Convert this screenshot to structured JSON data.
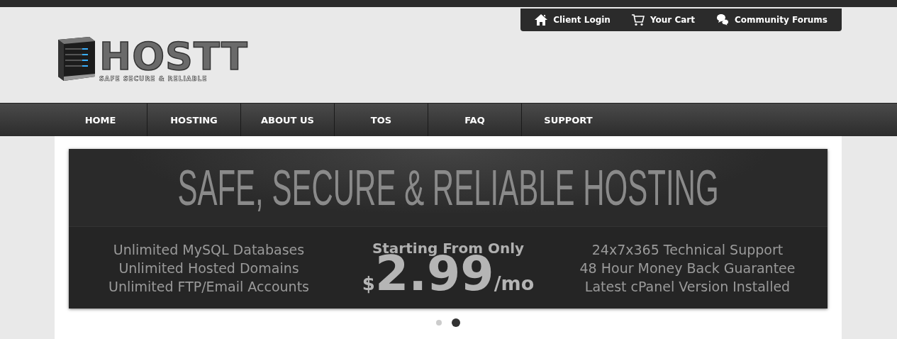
{
  "top_links": [
    {
      "kind": "home",
      "label": "Client Login"
    },
    {
      "kind": "cart",
      "label": "Your Cart"
    },
    {
      "kind": "forum",
      "label": "Community Forums"
    }
  ],
  "logo": {
    "name": "HOSTT",
    "tagline": "SAFE SECURE & RELIABLE"
  },
  "nav": [
    {
      "label": "HOME"
    },
    {
      "label": "HOSTING"
    },
    {
      "label": "ABOUT US"
    },
    {
      "label": "TOS"
    },
    {
      "label": "FAQ"
    },
    {
      "label": "SUPPORT"
    }
  ],
  "banner": {
    "headline": "SAFE, SECURE & RELIABLE HOSTING",
    "left_features": [
      "Unlimited MySQL Databases",
      "Unlimited Hosted Domains",
      "Unlimited FTP/Email Accounts"
    ],
    "price_intro": "Starting From Only",
    "currency": "$",
    "price": "2.99",
    "period": "/mo",
    "right_features": [
      "24x7x365 Technical Support",
      "48 Hour Money Back Guarantee",
      "Latest cPanel Version Installed"
    ]
  },
  "slider_dots": [
    {
      "selected": false
    },
    {
      "selected": true
    }
  ]
}
